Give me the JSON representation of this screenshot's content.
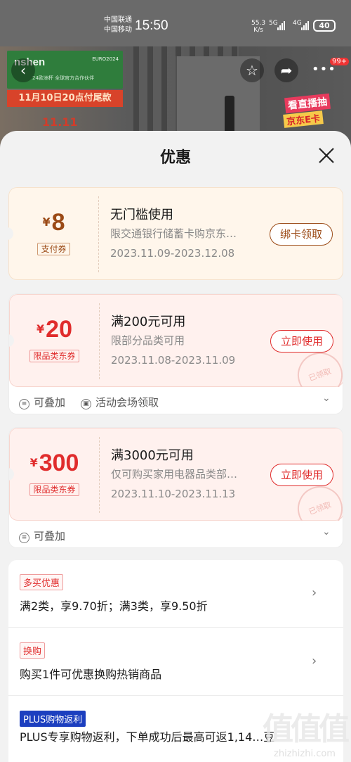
{
  "status_bar": {
    "carrier_1": "中国联通",
    "carrier_2": "中国移动",
    "time": "15:50",
    "net_speed": "55.3",
    "net_unit": "K/s",
    "sig1": "5G",
    "sig2": "4G",
    "battery": "40"
  },
  "banner": {
    "brand": "nshen",
    "brand_sub": "24欧洲杯 全球官方合作伙伴",
    "brand_euro": "EURO2024",
    "promo": "11月10日20点付尾款",
    "eleven": "11.11",
    "live_1": "看直播抽",
    "live_2": "京东E卡",
    "cart_badge": "99+"
  },
  "sheet": {
    "title": "优惠"
  },
  "coupons": [
    {
      "currency": "¥",
      "amount": "8",
      "tag": "支付券",
      "title": "无门槛使用",
      "desc": "限交通银行储蓄卡购京东…",
      "date": "2023.11.09-2023.12.08",
      "button": "绑卡领取"
    },
    {
      "currency": "¥",
      "amount": "20",
      "tag": "限品类东券",
      "title": "满200元可用",
      "desc": "限部分品类可用",
      "date": "2023.11.08-2023.11.09",
      "button": "立即使用",
      "stamp": "已领取",
      "foot_1": "可叠加",
      "foot_2": "活动会场领取"
    },
    {
      "currency": "¥",
      "amount": "300",
      "tag": "限品类东券",
      "title": "满3000元可用",
      "desc": "仅可购买家用电器品类部…",
      "date": "2023.11.10-2023.11.13",
      "button": "立即使用",
      "stamp": "已领取",
      "foot_1": "可叠加"
    }
  ],
  "promotions": [
    {
      "tag": "多买优惠",
      "text": "满2类，享9.70折；满3类，享9.50折"
    },
    {
      "tag": "换购",
      "text": "购买1件可优惠换购热销商品"
    },
    {
      "tag": "PLUS购物返利",
      "text": "PLUS专享购物返利，下单成功后最高可返1,14…豆"
    }
  ],
  "watermark": {
    "text": "值值值",
    "url": "zhizhizhi.com"
  }
}
